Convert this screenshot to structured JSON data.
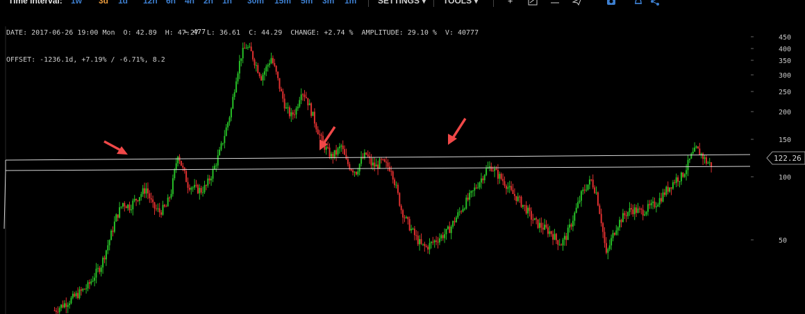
{
  "toolbar": {
    "title": "Time interval:",
    "intervals": [
      {
        "label": "1w",
        "color": "#3d7fd0"
      },
      {
        "label": "3d",
        "color": "#e89a3c"
      },
      {
        "label": "1d",
        "color": "#3d7fd0"
      },
      {
        "label": "12h",
        "color": "#3d7fd0"
      },
      {
        "label": "6h",
        "color": "#3d7fd0"
      },
      {
        "label": "4h",
        "color": "#3d7fd0"
      },
      {
        "label": "2h",
        "color": "#3d7fd0"
      },
      {
        "label": "1h",
        "color": "#3d7fd0"
      },
      {
        "label": "30m",
        "color": "#3d7fd0"
      },
      {
        "label": "15m",
        "color": "#3d7fd0"
      },
      {
        "label": "5m",
        "color": "#3d7fd0"
      },
      {
        "label": "3m",
        "color": "#3d7fd0"
      },
      {
        "label": "1m",
        "color": "#3d7fd0"
      }
    ],
    "settings_label": "SETTINGS ▾",
    "tools_label": "TOOLS ▾",
    "icons": [
      "plus-icon",
      "draw-line-icon",
      "horizontal-line-icon",
      "paper-plane-icon",
      "camera-icon",
      "bell-icon",
      "share-icon"
    ]
  },
  "info": {
    "date": "DATE: 2017-06-26 19:00 Mon",
    "open": "O: 42.89",
    "high": "H: 47.27",
    "low": "L: 36.61",
    "close": "C: 44.29",
    "change": "CHANGE: +2.74 %",
    "amplitude": "AMPLITUDE: 29.10 %",
    "volume": "V: 40777",
    "offset": "OFFSET: -1236.1d, +7.19% / -6.71%, 8.2"
  },
  "chart_data": {
    "type": "candlestick",
    "y_scale": "log",
    "y_ticks": [
      "450",
      "400",
      "350",
      "300",
      "250",
      "200",
      "150",
      "100",
      "50"
    ],
    "high_label": "← 477",
    "last_price": "122.26",
    "colors": {
      "up": "#27c127",
      "down": "#e03030",
      "background": "#000000",
      "trendline": "#d9d9d9",
      "arrow": "#f04848"
    },
    "annotations": [
      "horizontal-channel",
      "arrow",
      "arrow",
      "arrow"
    ],
    "close_path": [
      [
        0,
        23
      ],
      [
        10,
        26
      ],
      [
        20,
        30
      ],
      [
        28,
        38
      ],
      [
        33,
        50
      ],
      [
        37,
        64
      ],
      [
        41,
        75
      ],
      [
        45,
        72
      ],
      [
        50,
        80
      ],
      [
        55,
        88
      ],
      [
        59,
        72
      ],
      [
        63,
        68
      ],
      [
        67,
        72
      ],
      [
        70,
        85
      ],
      [
        74,
        130
      ],
      [
        77,
        108
      ],
      [
        80,
        92
      ],
      [
        84,
        88
      ],
      [
        88,
        86
      ],
      [
        91,
        90
      ],
      [
        95,
        106
      ],
      [
        99,
        130
      ],
      [
        103,
        170
      ],
      [
        106,
        210
      ],
      [
        109,
        300
      ],
      [
        112,
        380
      ],
      [
        115,
        420
      ],
      [
        118,
        390
      ],
      [
        121,
        340
      ],
      [
        124,
        300
      ],
      [
        127,
        330
      ],
      [
        130,
        370
      ],
      [
        133,
        310
      ],
      [
        136,
        250
      ],
      [
        139,
        210
      ],
      [
        142,
        195
      ],
      [
        145,
        210
      ],
      [
        148,
        260
      ],
      [
        151,
        240
      ],
      [
        154,
        205
      ],
      [
        157,
        175
      ],
      [
        160,
        150
      ],
      [
        163,
        135
      ],
      [
        166,
        125
      ],
      [
        169,
        130
      ],
      [
        172,
        140
      ],
      [
        175,
        118
      ],
      [
        178,
        110
      ],
      [
        181,
        106
      ],
      [
        184,
        120
      ],
      [
        187,
        128
      ],
      [
        190,
        115
      ],
      [
        193,
        112
      ],
      [
        196,
        118
      ],
      [
        199,
        113
      ],
      [
        202,
        110
      ],
      [
        205,
        88
      ],
      [
        208,
        70
      ],
      [
        211,
        62
      ],
      [
        214,
        56
      ],
      [
        217,
        51
      ],
      [
        220,
        47
      ],
      [
        223,
        46
      ],
      [
        226,
        48
      ],
      [
        229,
        50
      ],
      [
        232,
        52
      ],
      [
        235,
        54
      ],
      [
        238,
        58
      ],
      [
        241,
        64
      ],
      [
        244,
        70
      ],
      [
        247,
        76
      ],
      [
        250,
        82
      ],
      [
        253,
        90
      ],
      [
        256,
        98
      ],
      [
        259,
        108
      ],
      [
        262,
        112
      ],
      [
        265,
        104
      ],
      [
        268,
        98
      ],
      [
        271,
        92
      ],
      [
        274,
        84
      ],
      [
        277,
        80
      ],
      [
        280,
        75
      ],
      [
        283,
        70
      ],
      [
        286,
        64
      ],
      [
        289,
        60
      ],
      [
        292,
        58
      ],
      [
        295,
        56
      ],
      [
        298,
        54
      ],
      [
        301,
        50
      ],
      [
        304,
        48
      ],
      [
        307,
        52
      ],
      [
        310,
        60
      ],
      [
        313,
        70
      ],
      [
        316,
        82
      ],
      [
        319,
        90
      ],
      [
        322,
        96
      ],
      [
        325,
        84
      ],
      [
        328,
        62
      ],
      [
        331,
        42
      ],
      [
        334,
        50
      ],
      [
        337,
        58
      ],
      [
        340,
        63
      ],
      [
        343,
        67
      ],
      [
        346,
        70
      ],
      [
        349,
        69
      ],
      [
        352,
        68
      ],
      [
        355,
        70
      ],
      [
        358,
        72
      ],
      [
        361,
        75
      ],
      [
        364,
        80
      ],
      [
        367,
        86
      ],
      [
        370,
        92
      ],
      [
        373,
        98
      ],
      [
        376,
        100
      ],
      [
        379,
        110
      ],
      [
        382,
        125
      ],
      [
        385,
        135
      ],
      [
        388,
        128
      ],
      [
        391,
        118
      ],
      [
        394,
        114
      ]
    ]
  }
}
